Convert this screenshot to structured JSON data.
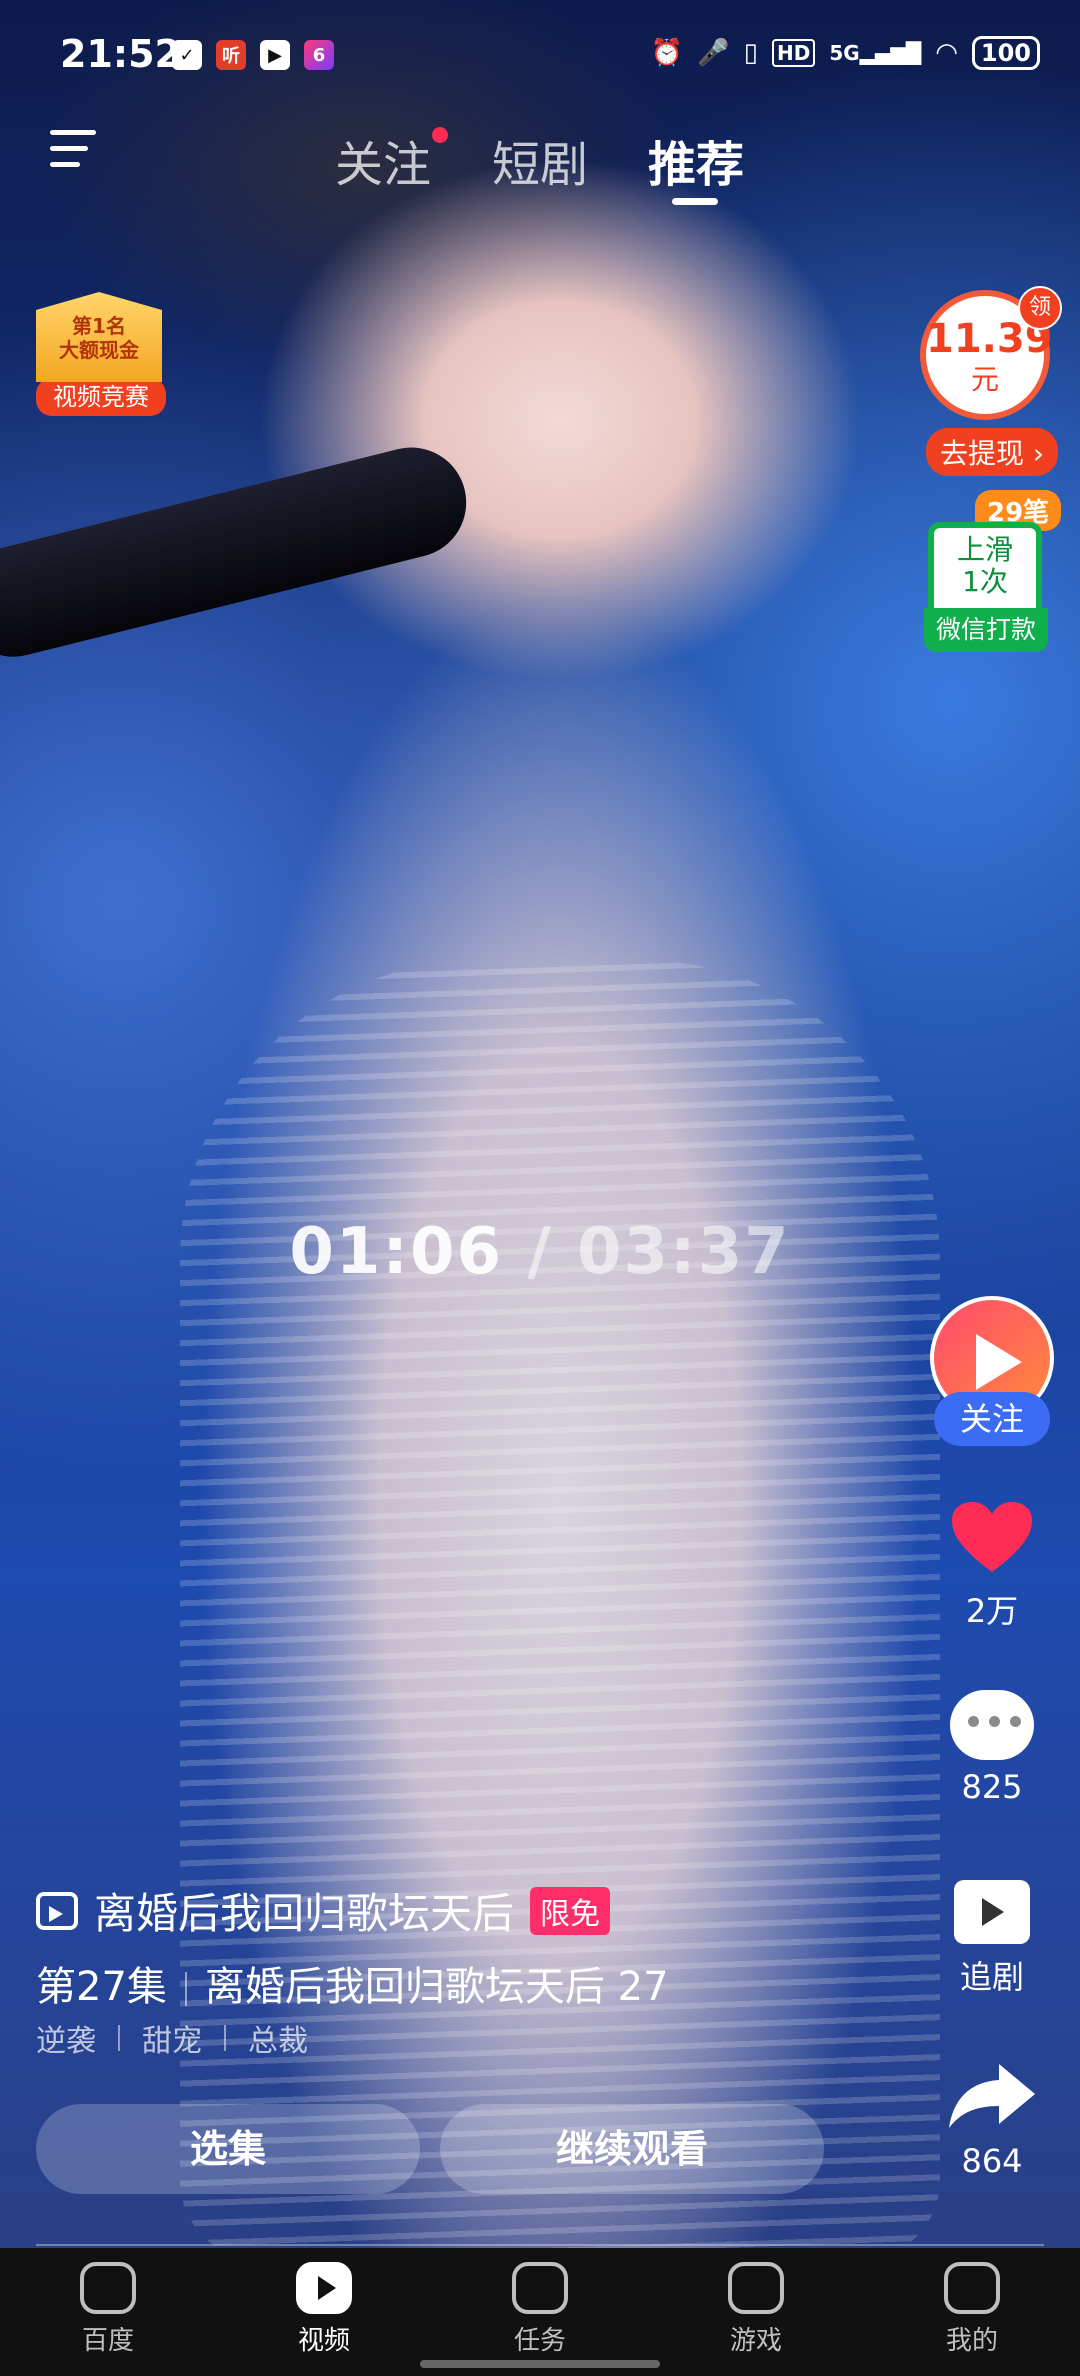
{
  "status_bar": {
    "time": "21:52",
    "notif_icons": [
      "check-icon",
      "listen-app-icon",
      "video-app-icon",
      "six-app-icon"
    ],
    "right_icons": [
      "alarm-icon",
      "mic-icon",
      "vibrate-icon",
      "hd-icon",
      "signal-5g-icon",
      "wifi-icon"
    ],
    "network": "5G",
    "hd": "HD",
    "battery": "100"
  },
  "top_tabs": [
    {
      "label": "关注",
      "active": false,
      "dot": true
    },
    {
      "label": "短剧",
      "active": false
    },
    {
      "label": "推荐",
      "active": true
    }
  ],
  "contest_badge": {
    "line1": "第1名",
    "line2": "大额现金",
    "label": "视频竞赛"
  },
  "cash_widget": {
    "amount": "11.39",
    "unit": "元",
    "claim": "领",
    "withdraw": "去提现"
  },
  "wechat_reward": {
    "count": "29笔",
    "line1": "上滑",
    "line2": "1次",
    "cta": "微信打款"
  },
  "playback": {
    "current": "01:06",
    "separator": "/",
    "total": "03:37"
  },
  "rail": {
    "follow": "关注",
    "likes": "2万",
    "comments": "825",
    "follow_drama": "追剧",
    "shares": "864"
  },
  "show": {
    "title": "离婚后我回归歌坛天后",
    "tag": "限免",
    "episode": "第27集",
    "episode_title": "离婚后我回归歌坛天后 27",
    "genres": [
      "逆袭",
      "甜宠",
      "总裁"
    ]
  },
  "actions": {
    "select_episode": "选集",
    "continue_watch": "继续观看"
  },
  "bottom_nav": [
    {
      "label": "百度",
      "icon": "smile-icon"
    },
    {
      "label": "视频",
      "icon": "video-icon",
      "active": true
    },
    {
      "label": "任务",
      "icon": "task-icon"
    },
    {
      "label": "游戏",
      "icon": "gamepad-icon"
    },
    {
      "label": "我的",
      "icon": "profile-icon"
    }
  ],
  "colors": {
    "accent_red": "#f0401f",
    "follow_blue": "#3d6cf4",
    "wechat_green": "#0fb04b"
  }
}
